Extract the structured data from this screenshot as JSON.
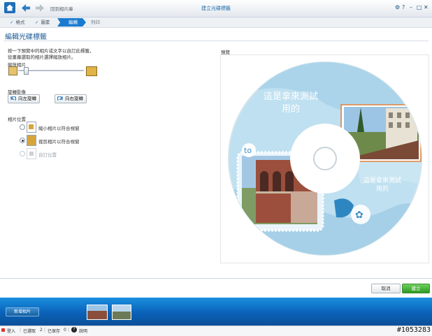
{
  "window": {
    "back_label": "回到相片庫",
    "title": "建立光碟標籤",
    "controls": [
      "⚙",
      "?",
      "–",
      "□",
      "✕"
    ]
  },
  "steps": [
    {
      "label": "格式",
      "state": "done"
    },
    {
      "label": "圖素",
      "state": "done"
    },
    {
      "label": "編輯",
      "state": "active"
    },
    {
      "label": "列印",
      "state": "pending"
    }
  ],
  "page_title": "編輯光碟標籤",
  "instructions": {
    "line1": "按一下預覽中的相片或文字以自訂此標籤，",
    "line2": "從畫幕選取的相片選擇縮放相片。"
  },
  "zoom": {
    "label": "縮放相片",
    "level": 0.12
  },
  "rotate": {
    "label": "旋轉影像",
    "left_button": "向左旋轉",
    "right_button": "向右旋轉"
  },
  "position": {
    "label": "相片位置",
    "options": [
      {
        "label": "縮小相片以符合視窗",
        "selected": false,
        "enabled": true
      },
      {
        "label": "裁剪相片以符合視窗",
        "selected": true,
        "enabled": true
      },
      {
        "label": "自訂位置",
        "selected": false,
        "enabled": false
      }
    ]
  },
  "preview": {
    "label": "預覽",
    "text_top": [
      "這是拿來測試",
      "用的"
    ],
    "text_right": [
      "這是拿來測試",
      "用的"
    ],
    "accent": "#e0803a",
    "disc_color": "#bfe0f0"
  },
  "actions": {
    "cancel": "取消",
    "apply": "建立"
  },
  "tray": {
    "add_button": "新增相片"
  },
  "status": {
    "sign_in": "登入",
    "selected": "已選取",
    "selected_count": "2",
    "saved": "已保存",
    "saved_count": "0",
    "help": "說明"
  },
  "watermark": "#1053283"
}
